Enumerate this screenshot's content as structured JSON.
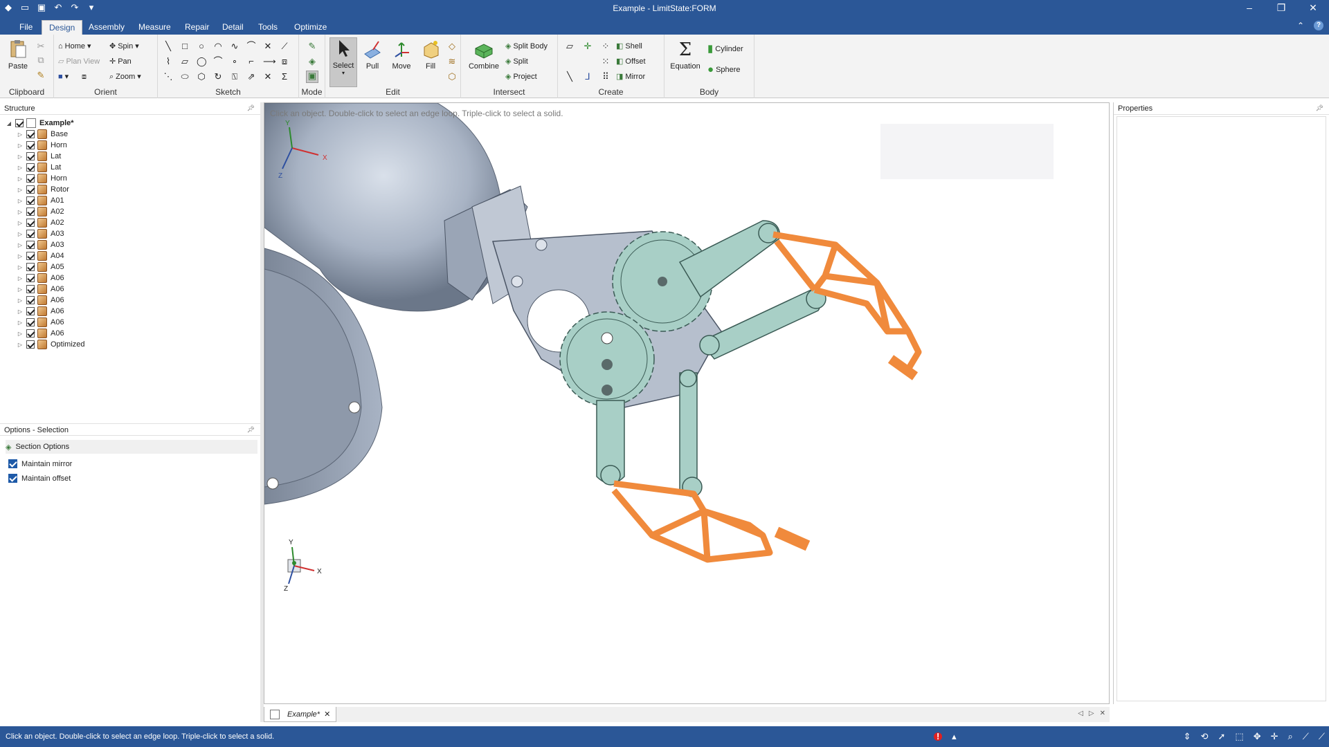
{
  "window": {
    "title": "Example - LimitState:FORM"
  },
  "tabs": [
    "File",
    "Design",
    "Assembly",
    "Measure",
    "Repair",
    "Detail",
    "Tools",
    "Optimize"
  ],
  "ribbon": {
    "clipboard": {
      "label": "Clipboard",
      "paste": "Paste"
    },
    "orient": {
      "label": "Orient",
      "home": "Home",
      "spin": "Spin",
      "plan_view": "Plan View",
      "pan": "Pan",
      "zoom": "Zoom"
    },
    "sketch": {
      "label": "Sketch"
    },
    "mode": {
      "label": "Mode"
    },
    "edit": {
      "label": "Edit",
      "select": "Select",
      "pull": "Pull",
      "move": "Move",
      "fill": "Fill"
    },
    "intersect": {
      "label": "Intersect",
      "combine": "Combine",
      "split_body": "Split Body",
      "split": "Split",
      "project": "Project"
    },
    "create": {
      "label": "Create",
      "shell": "Shell",
      "offset": "Offset",
      "mirror": "Mirror"
    },
    "body": {
      "label": "Body",
      "equation": "Equation",
      "cylinder": "Cylinder",
      "sphere": "Sphere"
    }
  },
  "structure": {
    "title": "Structure",
    "root": "Example*",
    "items": [
      "Base",
      "Horn",
      "Lat",
      "Lat",
      "Horn",
      "Rotor",
      "A01",
      "A02",
      "A02",
      "A03",
      "A03",
      "A04",
      "A05",
      "A06",
      "A06",
      "A06",
      "A06",
      "A06",
      "A06",
      "Optimized"
    ]
  },
  "options": {
    "title": "Options - Selection",
    "section_options": "Section Options",
    "maintain_mirror": "Maintain mirror",
    "maintain_offset": "Maintain offset"
  },
  "viewport": {
    "hint": "Click an object. Double-click to select an edge loop. Triple-click to select a solid.",
    "axis_x": "X",
    "axis_y": "Y",
    "axis_z": "Z"
  },
  "properties": {
    "title": "Properties"
  },
  "doc_tab": {
    "label": "Example*"
  },
  "status": {
    "message": "Click an object. Double-click to select an edge loop. Triple-click to select a solid."
  },
  "colors": {
    "chrome": "#2b5797",
    "part_gray": "#a9b3c2",
    "part_teal": "#a8cfc6",
    "part_orange": "#f08a3c"
  }
}
